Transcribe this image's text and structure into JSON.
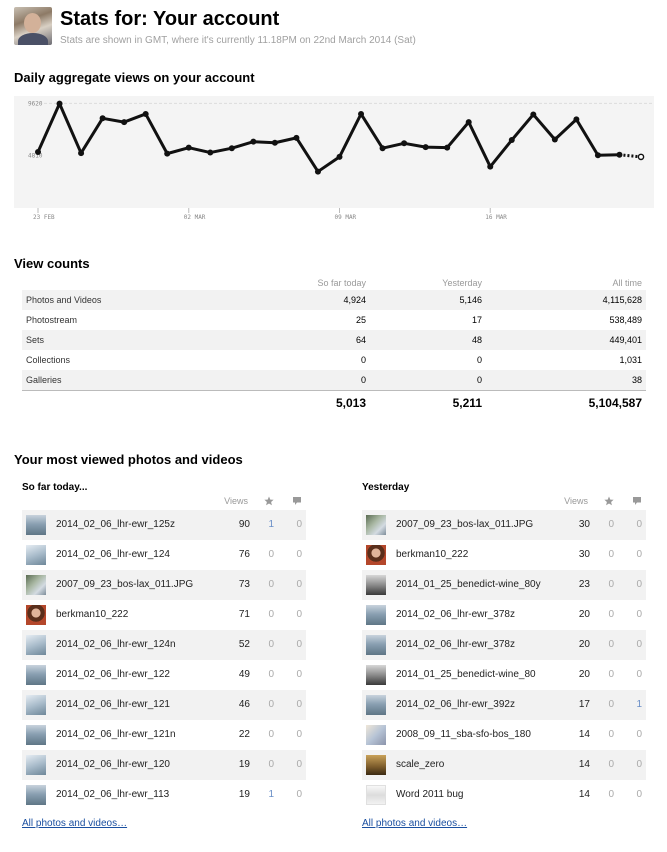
{
  "header": {
    "title": "Stats for: Your account",
    "subtitle": "Stats are shown in GMT, where it's currently 11.18PM on 22nd March 2014 (Sat)"
  },
  "chart_section": {
    "title": "Daily aggregate views on your account"
  },
  "chart_data": {
    "type": "line",
    "y_tick_labels": [
      "9620",
      "4810"
    ],
    "x_tick_labels": [
      "23 FEB",
      "02 MAR",
      "09 MAR",
      "16 MAR"
    ],
    "x_tick_day_index": [
      0,
      7,
      14,
      21
    ],
    "ylim": [
      0,
      10300
    ],
    "series": [
      {
        "values": [
          5150,
          9600,
          5050,
          8250,
          7900,
          8650,
          5000,
          5550,
          5100,
          5500,
          6100,
          6000,
          6450,
          3350,
          4700,
          8650,
          5500,
          5950,
          5600,
          5550,
          7900,
          3800,
          6250,
          8600,
          6300,
          8150,
          4850,
          4900,
          4700
        ],
        "partial_from_index": 27
      }
    ],
    "line_color": "#111111",
    "background": "#f4f4f4"
  },
  "view_counts": {
    "title": "View counts",
    "columns": [
      "So far today",
      "Yesterday",
      "All time"
    ],
    "rows": [
      {
        "label": "Photos and Videos",
        "today": "4,924",
        "yesterday": "5,146",
        "alltime": "4,115,628"
      },
      {
        "label": "Photostream",
        "today": "25",
        "yesterday": "17",
        "alltime": "538,489"
      },
      {
        "label": "Sets",
        "today": "64",
        "yesterday": "48",
        "alltime": "449,401"
      },
      {
        "label": "Collections",
        "today": "0",
        "yesterday": "0",
        "alltime": "1,031"
      },
      {
        "label": "Galleries",
        "today": "0",
        "yesterday": "0",
        "alltime": "38"
      }
    ],
    "totals": {
      "today": "5,013",
      "yesterday": "5,211",
      "alltime": "5,104,587"
    }
  },
  "most_viewed": {
    "title": "Your most viewed photos and videos",
    "col_views": "Views",
    "link_text": "All photos and videos…",
    "today": {
      "title": "So far today...",
      "items": [
        {
          "name": "2014_02_06_lhr-ewr_125z",
          "views": "90",
          "favs": "1",
          "comments": "0",
          "thumb": "plane"
        },
        {
          "name": "2014_02_06_lhr-ewr_124",
          "views": "76",
          "favs": "0",
          "comments": "0",
          "thumb": "clouds"
        },
        {
          "name": "2007_09_23_bos-lax_011.JPG",
          "views": "73",
          "favs": "0",
          "comments": "0",
          "thumb": "aerial"
        },
        {
          "name": "berkman10_222",
          "views": "71",
          "favs": "0",
          "comments": "0",
          "thumb": "person"
        },
        {
          "name": "2014_02_06_lhr-ewr_124n",
          "views": "52",
          "favs": "0",
          "comments": "0",
          "thumb": "clouds"
        },
        {
          "name": "2014_02_06_lhr-ewr_122",
          "views": "49",
          "favs": "0",
          "comments": "0",
          "thumb": "plane"
        },
        {
          "name": "2014_02_06_lhr-ewr_121",
          "views": "46",
          "favs": "0",
          "comments": "0",
          "thumb": "clouds"
        },
        {
          "name": "2014_02_06_lhr-ewr_121n",
          "views": "22",
          "favs": "0",
          "comments": "0",
          "thumb": "plane"
        },
        {
          "name": "2014_02_06_lhr-ewr_120",
          "views": "19",
          "favs": "0",
          "comments": "0",
          "thumb": "clouds"
        },
        {
          "name": "2014_02_06_lhr-ewr_113",
          "views": "19",
          "favs": "1",
          "comments": "0",
          "thumb": "plane"
        }
      ]
    },
    "yesterday": {
      "title": "Yesterday",
      "items": [
        {
          "name": "2007_09_23_bos-lax_011.JPG",
          "views": "30",
          "favs": "0",
          "comments": "0",
          "thumb": "aerial"
        },
        {
          "name": "berkman10_222",
          "views": "30",
          "favs": "0",
          "comments": "0",
          "thumb": "person"
        },
        {
          "name": "2014_01_25_benedict-wine_80y",
          "views": "23",
          "favs": "0",
          "comments": "0",
          "thumb": "wine"
        },
        {
          "name": "2014_02_06_lhr-ewr_378z",
          "views": "20",
          "favs": "0",
          "comments": "0",
          "thumb": "plane"
        },
        {
          "name": "2014_02_06_lhr-ewr_378z",
          "views": "20",
          "favs": "0",
          "comments": "0",
          "thumb": "plane"
        },
        {
          "name": "2014_01_25_benedict-wine_80",
          "views": "20",
          "favs": "0",
          "comments": "0",
          "thumb": "wine"
        },
        {
          "name": "2014_02_06_lhr-ewr_392z",
          "views": "17",
          "favs": "0",
          "comments": "1",
          "thumb": "plane"
        },
        {
          "name": "2008_09_11_sba-sfo-bos_180",
          "views": "14",
          "favs": "0",
          "comments": "0",
          "thumb": "sunset"
        },
        {
          "name": "scale_zero",
          "views": "14",
          "favs": "0",
          "comments": "0",
          "thumb": "scale"
        },
        {
          "name": "Word 2011 bug",
          "views": "14",
          "favs": "0",
          "comments": "0",
          "thumb": "word"
        }
      ]
    }
  }
}
